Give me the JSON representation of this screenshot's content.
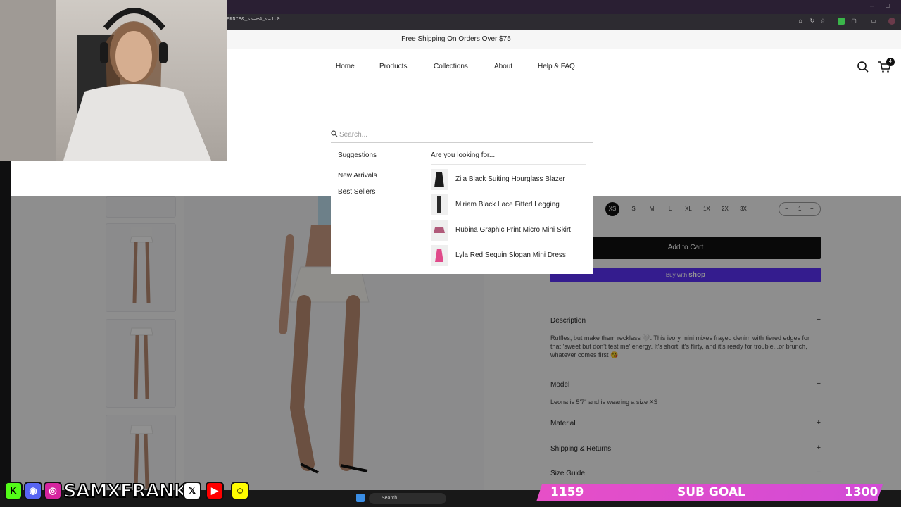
{
  "browser": {
    "address": "ERNIE&_ss=e&_v=1.0",
    "window_controls": [
      "–",
      "□",
      "×"
    ]
  },
  "site": {
    "announcement": "Free Shipping On Orders Over $75",
    "nav": [
      {
        "label": "Home"
      },
      {
        "label": "Products"
      },
      {
        "label": "Collections"
      },
      {
        "label": "About"
      },
      {
        "label": "Help & FAQ"
      }
    ],
    "cart_count": "4"
  },
  "search": {
    "placeholder": "Search...",
    "suggestions_heading": "Suggestions",
    "suggestions": [
      "New Arrivals",
      "Best Sellers"
    ],
    "looking_heading": "Are you looking for...",
    "products": [
      {
        "name": "Zila Black Suiting Hourglass Blazer",
        "icon": "blazer-thumb",
        "color": "#1a1a1a"
      },
      {
        "name": "Miriam Black Lace Fitted Legging",
        "icon": "legging-thumb",
        "color": "#2a2a2a"
      },
      {
        "name": "Rubina Graphic Print Micro Mini Skirt",
        "icon": "skirt-thumb",
        "color": "#b05a7a"
      },
      {
        "name": "Lyla Red Sequin Slogan Mini Dress",
        "icon": "dress-thumb",
        "color": "#e04a8a"
      }
    ]
  },
  "product": {
    "sizes": [
      "XS",
      "S",
      "M",
      "L",
      "XL",
      "1X",
      "2X",
      "3X"
    ],
    "selected_size": "XS",
    "quantity": "1",
    "add_to_cart": "Add to Cart",
    "buy_with": "Buy with",
    "shop_brand": "shop",
    "description_title": "Description",
    "description_text": "Ruffles, but make them reckless 🤍. This ivory mini mixes frayed denim with tiered edges for that 'sweet but don't test me' energy. It's short, it's flirty, and it's ready for trouble...or brunch, whatever comes first 😘",
    "model_title": "Model",
    "model_text": "Leona is 5'7\" and is wearing a size XS",
    "material_title": "Material",
    "shipping_title": "Shipping & Returns",
    "size_guide_title": "Size Guide"
  },
  "stream": {
    "handle": "SAMXFRANK",
    "goal_current": "1159",
    "goal_label": "SUB GOAL",
    "goal_target": "1300",
    "taskbar_search": "Search"
  }
}
